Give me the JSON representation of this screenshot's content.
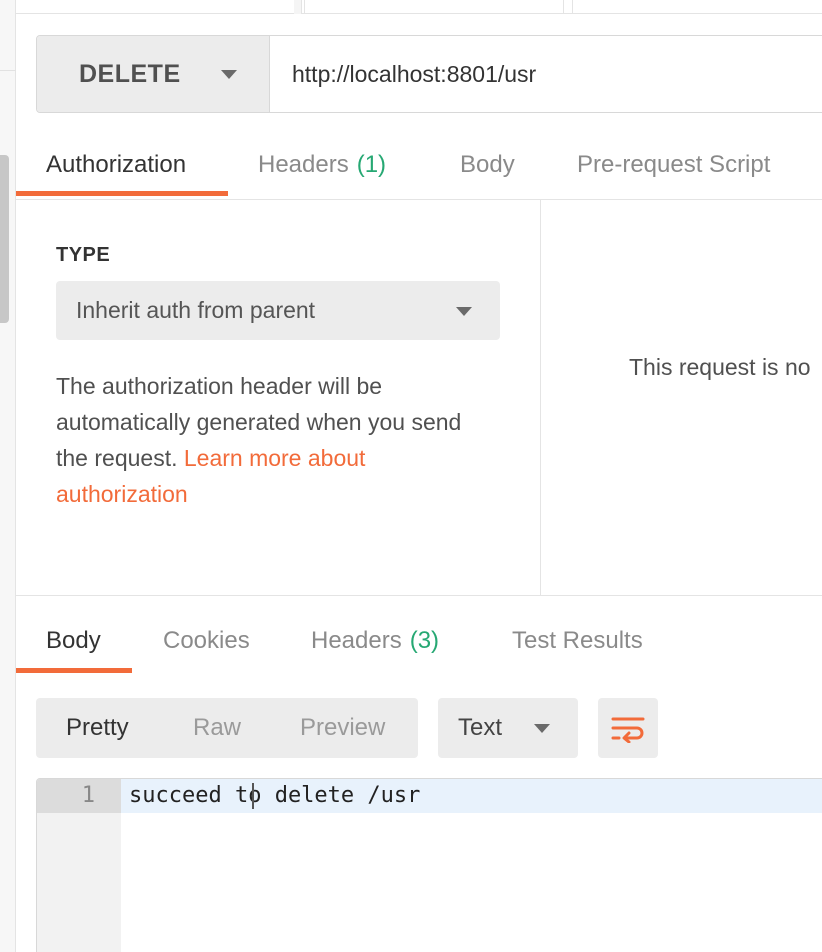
{
  "request": {
    "method": "DELETE",
    "url": "http://localhost:8801/usr"
  },
  "request_tabs": [
    {
      "label": "Authorization",
      "count": ""
    },
    {
      "label": "Headers",
      "count": "(1)"
    },
    {
      "label": "Body",
      "count": ""
    },
    {
      "label": "Pre-request Script",
      "count": ""
    }
  ],
  "auth": {
    "type_label": "TYPE",
    "type_value": "Inherit auth from parent",
    "description": "The authorization header will be automatically generated when you send the request. ",
    "link_text": "Learn more about authorization"
  },
  "right_panel": {
    "message": "This request is no"
  },
  "response_tabs": [
    {
      "label": "Body",
      "count": ""
    },
    {
      "label": "Cookies",
      "count": ""
    },
    {
      "label": "Headers",
      "count": "(3)"
    },
    {
      "label": "Test Results",
      "count": ""
    }
  ],
  "response_toolbar": {
    "views": [
      "Pretty",
      "Raw",
      "Preview"
    ],
    "format": "Text",
    "wrap_icon": "wrap-lines-icon"
  },
  "editor": {
    "line_number": "1",
    "line_text": "succeed to delete /usr"
  },
  "colors": {
    "accent": "#f26b3a",
    "count_green": "#26a873"
  }
}
